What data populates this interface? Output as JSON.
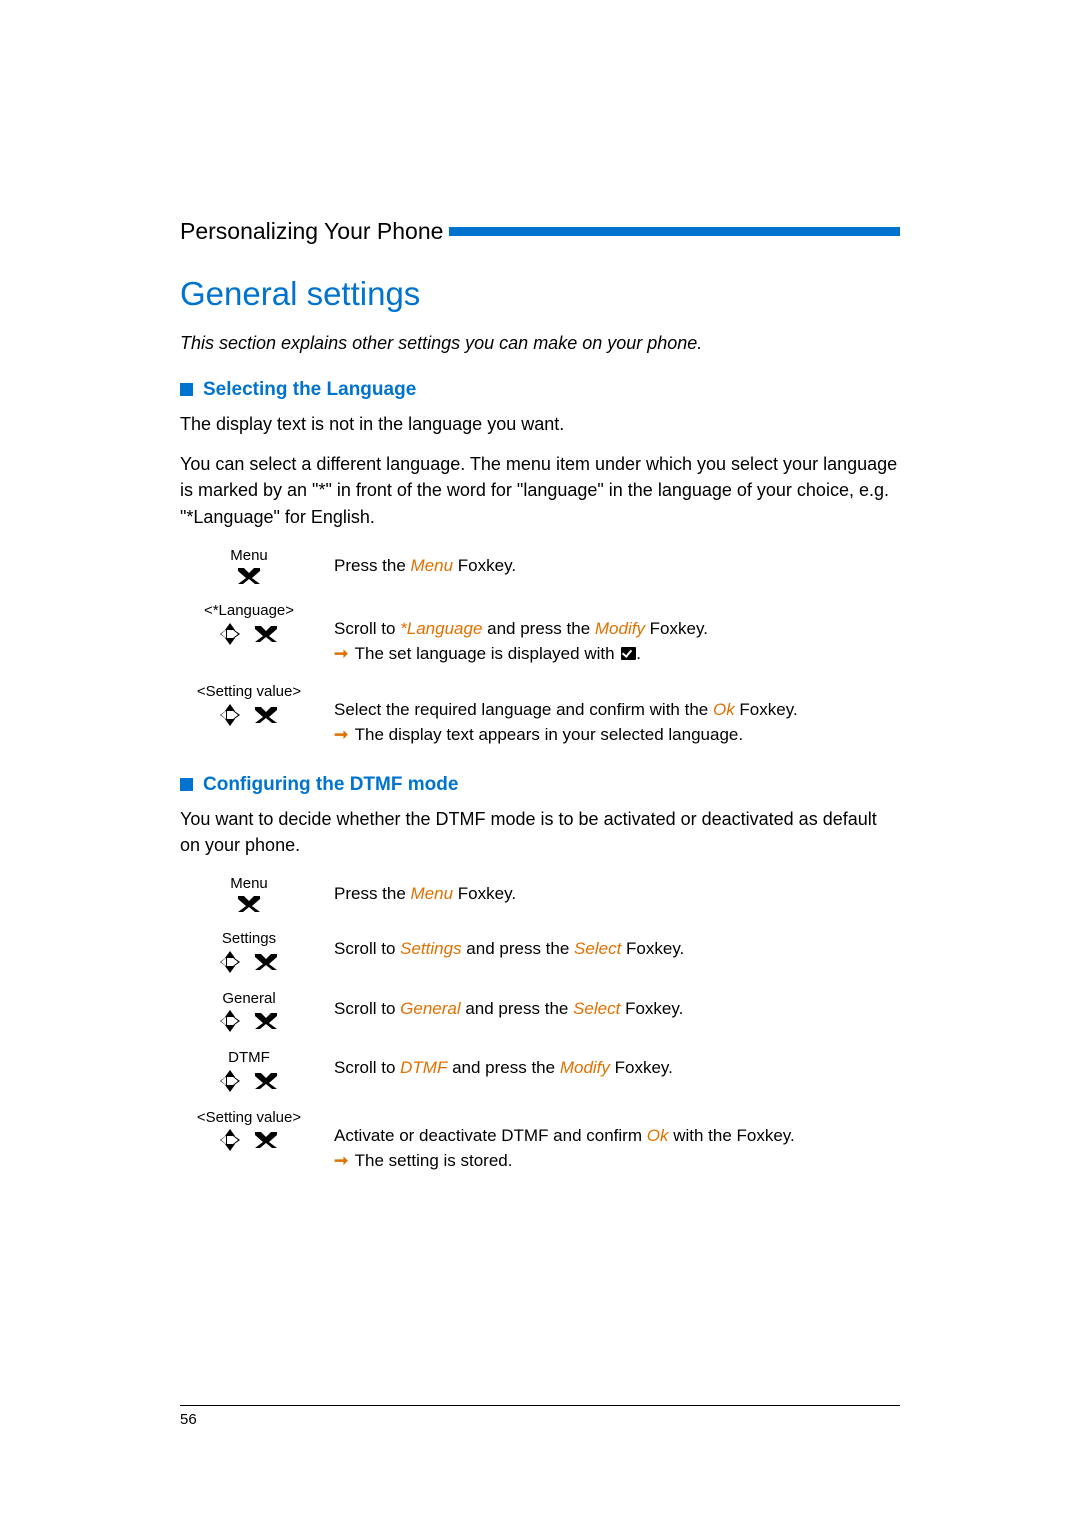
{
  "header": {
    "breadcrumb": "Personalizing Your Phone"
  },
  "page_number": "56",
  "h1": "General settings",
  "intro": "This section explains other settings you can make on your phone.",
  "section1": {
    "title": "Selecting the Language",
    "p1": "The display text is not in the language you want.",
    "p2": "You can select a different language. The menu item under which you select your language is marked by an \"*\" in front of the word for \"language\" in the language of your choice, e.g. \"*Language\" for English.",
    "steps": [
      {
        "label": "Menu",
        "icon": "foxkey",
        "line1": {
          "pre": "Press the ",
          "term": "Menu",
          "post": " Foxkey."
        }
      },
      {
        "label": "<*Language>",
        "icon": "nav",
        "line1": {
          "pre": "Scroll to ",
          "term": "*Language",
          "mid": " and press the ",
          "term2": "Modify",
          "post": " Foxkey."
        },
        "line2": {
          "arrow": true,
          "text": "The set language is displayed with ",
          "check": true,
          "post": "."
        }
      },
      {
        "label": "<Setting value>",
        "icon": "nav",
        "line1": {
          "pre": "Select the required language and confirm with the  ",
          "term": "Ok",
          "post": "  Foxkey."
        },
        "line2": {
          "arrow": true,
          "text": "The display text appears in your selected language."
        }
      }
    ]
  },
  "section2": {
    "title": "Configuring the DTMF mode",
    "p1": "You want to decide whether the DTMF mode is to be activated or deactivated as default on your phone.",
    "steps": [
      {
        "label": "Menu",
        "icon": "foxkey",
        "line1": {
          "pre": "Press the ",
          "term": "Menu",
          "post": " Foxkey."
        }
      },
      {
        "label": "Settings",
        "icon": "nav",
        "line1": {
          "pre": "Scroll to ",
          "term": "Settings",
          "mid": " and press the ",
          "term2": "Select",
          "post": " Foxkey."
        }
      },
      {
        "label": "General",
        "icon": "nav",
        "line1": {
          "pre": "Scroll to ",
          "term": "General",
          "mid": " and press the ",
          "term2": "Select",
          "post": " Foxkey."
        }
      },
      {
        "label": "DTMF",
        "icon": "nav",
        "line1": {
          "pre": "Scroll to ",
          "term": "DTMF",
          "mid": " and press the ",
          "term2": "Modify",
          "post": " Foxkey."
        }
      },
      {
        "label": "<Setting value>",
        "icon": "nav",
        "line1": {
          "pre": "Activate or deactivate DTMF and confirm ",
          "term": "Ok",
          "post": " with the Foxkey."
        },
        "line2": {
          "arrow": true,
          "text": "The setting is stored."
        }
      }
    ]
  }
}
